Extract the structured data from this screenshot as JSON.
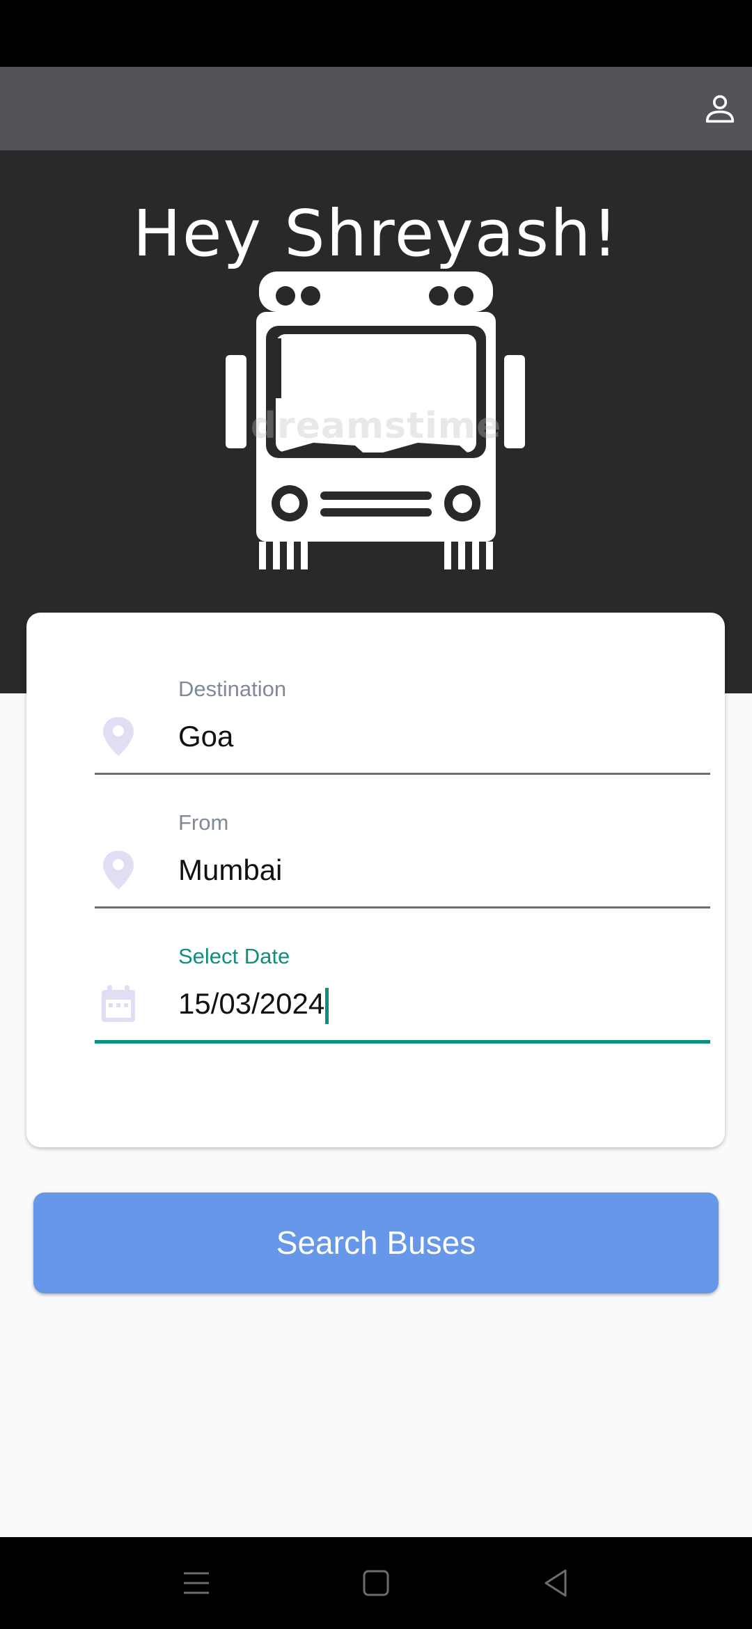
{
  "header": {
    "profile_icon": "person-outline-icon"
  },
  "hero": {
    "greeting": "Hey Shreyash!",
    "image_name": "bus-front-illustration",
    "watermark": "dreamstime"
  },
  "form": {
    "destination": {
      "label": "Destination",
      "value": "Goa",
      "icon": "location-pin-icon"
    },
    "from": {
      "label": "From",
      "value": "Mumbai",
      "icon": "location-pin-icon"
    },
    "date": {
      "label": "Select Date",
      "value": "15/03/2024",
      "icon": "calendar-icon"
    }
  },
  "actions": {
    "search_label": "Search Buses"
  },
  "nav": {
    "recent_icon": "menu-lines-icon",
    "home_icon": "square-home-icon",
    "back_icon": "triangle-back-icon"
  },
  "colors": {
    "app_bar": "#535358",
    "hero_background": "#29282a",
    "accent": "#0e8f7e",
    "button": "#6797e9",
    "icon_tint": "#e1ddf2",
    "label": "#80899a"
  }
}
